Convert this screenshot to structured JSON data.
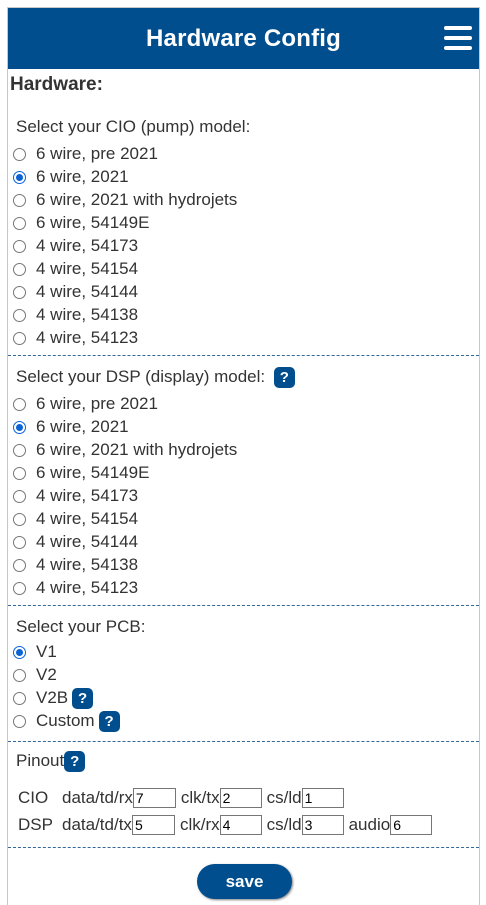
{
  "header": {
    "title": "Hardware Config"
  },
  "hardware_title": "Hardware:",
  "cio": {
    "label": "Select your CIO (pump) model:",
    "options": [
      "6 wire, pre 2021",
      "6 wire, 2021",
      "6 wire, 2021 with hydrojets",
      "6 wire, 54149E",
      "4 wire, 54173",
      "4 wire, 54154",
      "4 wire, 54144",
      "4 wire, 54138",
      "4 wire, 54123"
    ],
    "selected_index": 1
  },
  "dsp": {
    "label": "Select your DSP (display) model:",
    "help": "?",
    "options": [
      "6 wire, pre 2021",
      "6 wire, 2021",
      "6 wire, 2021 with hydrojets",
      "6 wire, 54149E",
      "4 wire, 54173",
      "4 wire, 54154",
      "4 wire, 54144",
      "4 wire, 54138",
      "4 wire, 54123"
    ],
    "selected_index": 1
  },
  "pcb": {
    "label": "Select your PCB:",
    "options": [
      {
        "label": "V1",
        "help": ""
      },
      {
        "label": "V2",
        "help": ""
      },
      {
        "label": "V2B",
        "help": "?"
      },
      {
        "label": "Custom",
        "help": "?"
      }
    ],
    "selected_index": 0
  },
  "pinout": {
    "label": "Pinout",
    "help": "?",
    "cio": {
      "label": "CIO",
      "data_label": "data/td/rx",
      "data_value": "7",
      "clk_label": "clk/tx",
      "clk_value": "2",
      "cs_label": "cs/ld",
      "cs_value": "1"
    },
    "dsp": {
      "label": "DSP",
      "data_label": "data/td/tx",
      "data_value": "5",
      "clk_label": "clk/rx",
      "clk_value": "4",
      "cs_label": "cs/ld",
      "cs_value": "3",
      "audio_label": "audio",
      "audio_value": "6"
    }
  },
  "save_label": "save",
  "colors": {
    "header_bg": "#004e8e",
    "accent": "#0b63d6"
  }
}
